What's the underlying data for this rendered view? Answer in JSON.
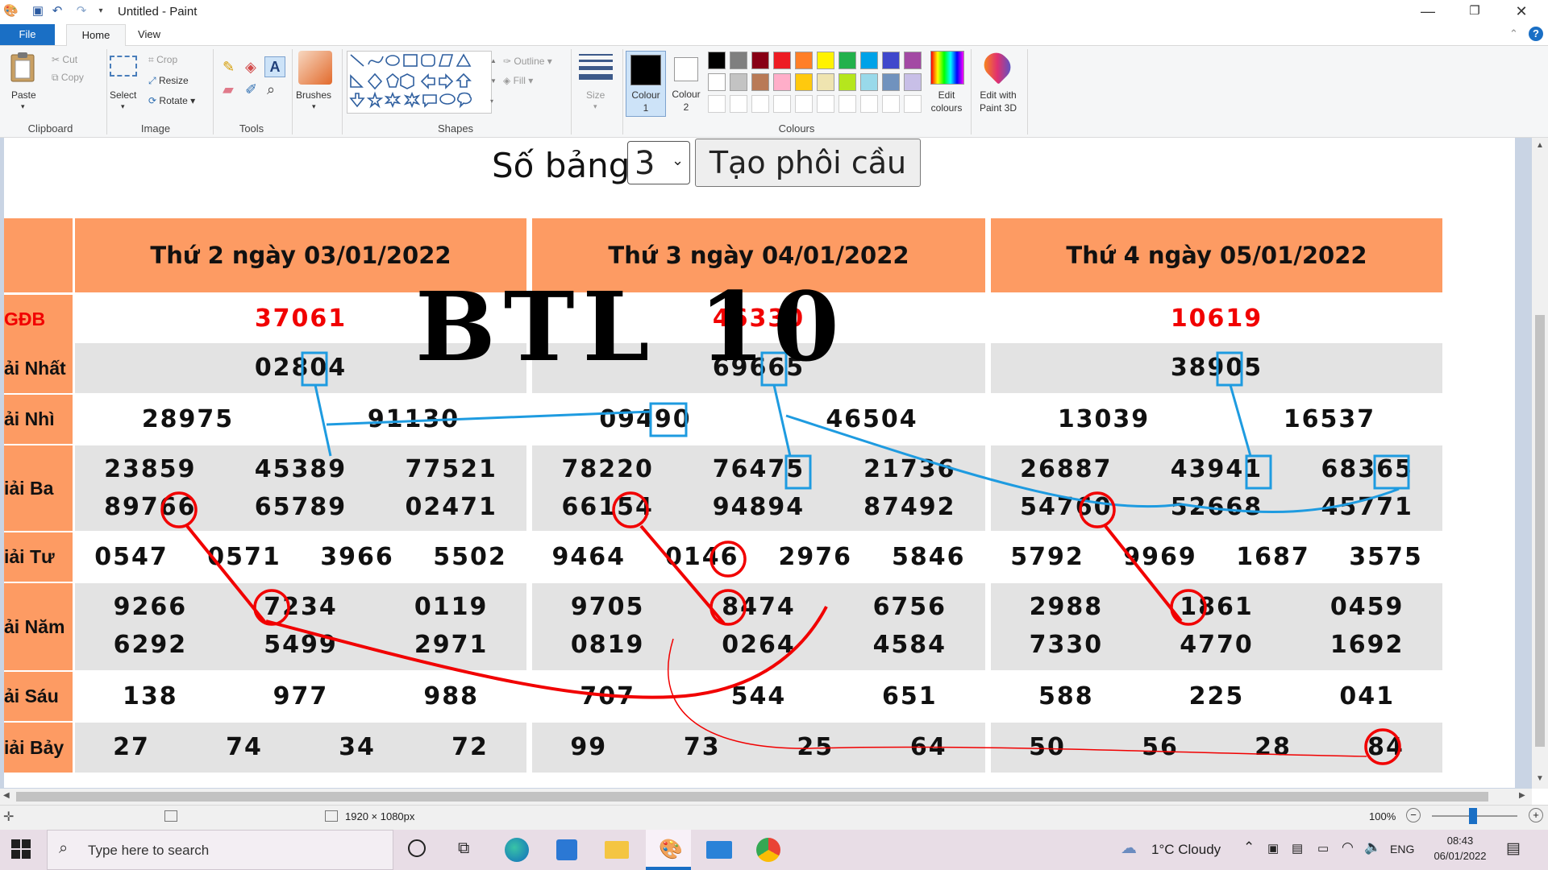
{
  "window": {
    "title": "Untitled - Paint"
  },
  "menu_tabs": [
    "File",
    "Home",
    "View"
  ],
  "ribbon": {
    "clipboard": {
      "paste": "Paste",
      "cut": "Cut",
      "copy": "Copy",
      "label": "Clipboard"
    },
    "image": {
      "select": "Select",
      "crop": "Crop",
      "resize": "Resize",
      "rotate": "Rotate",
      "label": "Image"
    },
    "tools": {
      "label": "Tools"
    },
    "brushes": {
      "label": "Brushes"
    },
    "shapes": {
      "outline": "Outline",
      "fill": "Fill",
      "label": "Shapes"
    },
    "size": {
      "label": "Size"
    },
    "colour1": {
      "line1": "Colour",
      "line2": "1"
    },
    "colour2": {
      "line1": "Colour",
      "line2": "2"
    },
    "colours": {
      "label": "Colours",
      "edit_line1": "Edit",
      "edit_line2": "colours"
    },
    "paint3d": {
      "line1": "Edit with",
      "line2": "Paint 3D"
    },
    "palette_row1": [
      "#000000",
      "#7f7f7f",
      "#880015",
      "#ed1c24",
      "#ff7f27",
      "#fff200",
      "#22b14c",
      "#00a2e8",
      "#3f48cc",
      "#a349a4"
    ],
    "palette_row2": [
      "#ffffff",
      "#c3c3c3",
      "#b97a57",
      "#ffaec9",
      "#ffc90e",
      "#efe4b0",
      "#b5e61d",
      "#99d9ea",
      "#7092be",
      "#c8bfe7"
    ]
  },
  "page": {
    "so_bang_label": "Số bảng",
    "so_bang_value": "3",
    "button": "Tạo phôi cầu",
    "overlay_text": "BTL 10",
    "labels": [
      "GĐB",
      "ải Nhất",
      "ải Nhì",
      "iải Ba",
      "iải Tư",
      "ải Năm",
      "ải Sáu",
      "iải Bảy"
    ],
    "days": [
      {
        "header": "Thứ 2 ngày 03/01/2022",
        "gdb": "37061",
        "nhat": "02804",
        "nhi": [
          "28975",
          "91130"
        ],
        "ba": [
          "23859",
          "45389",
          "77521",
          "89766",
          "65789",
          "02471"
        ],
        "tu": [
          "0547",
          "0571",
          "3966",
          "5502"
        ],
        "nam": [
          "9266",
          "7234",
          "0119",
          "6292",
          "5499",
          "2971"
        ],
        "sau": [
          "138",
          "977",
          "988"
        ],
        "bay": [
          "27",
          "74",
          "34",
          "72"
        ]
      },
      {
        "header": "Thứ 3 ngày 04/01/2022",
        "gdb": "46330",
        "nhat": "69665",
        "nhi": [
          "09490",
          "46504"
        ],
        "ba": [
          "78220",
          "76475",
          "21736",
          "66154",
          "94894",
          "87492"
        ],
        "tu": [
          "9464",
          "0146",
          "2976",
          "5846"
        ],
        "nam": [
          "9705",
          "8474",
          "6756",
          "0819",
          "0264",
          "4584"
        ],
        "sau": [
          "707",
          "544",
          "651"
        ],
        "bay": [
          "99",
          "73",
          "25",
          "64"
        ]
      },
      {
        "header": "Thứ 4 ngày 05/01/2022",
        "gdb": "10619",
        "nhat": "38905",
        "nhi": [
          "13039",
          "16537"
        ],
        "ba": [
          "26887",
          "43941",
          "68365",
          "54760",
          "52668",
          "45771"
        ],
        "tu": [
          "5792",
          "9969",
          "1687",
          "3575"
        ],
        "nam": [
          "2988",
          "1861",
          "0459",
          "7330",
          "4770",
          "1692"
        ],
        "sau": [
          "588",
          "225",
          "041"
        ],
        "bay": [
          "50",
          "56",
          "28",
          "84"
        ]
      }
    ]
  },
  "statusbar": {
    "dimensions": "1920 × 1080px",
    "zoom": "100%"
  },
  "taskbar": {
    "search_placeholder": "Type here to search",
    "weather": "1°C  Cloudy",
    "lang": "ENG",
    "time": "08:43",
    "date": "06/01/2022"
  },
  "colors": {
    "accent": "#1a6fc5",
    "header_orange": "#fd9b63",
    "red": "#f10000",
    "blue_box": "#1e9be0"
  }
}
